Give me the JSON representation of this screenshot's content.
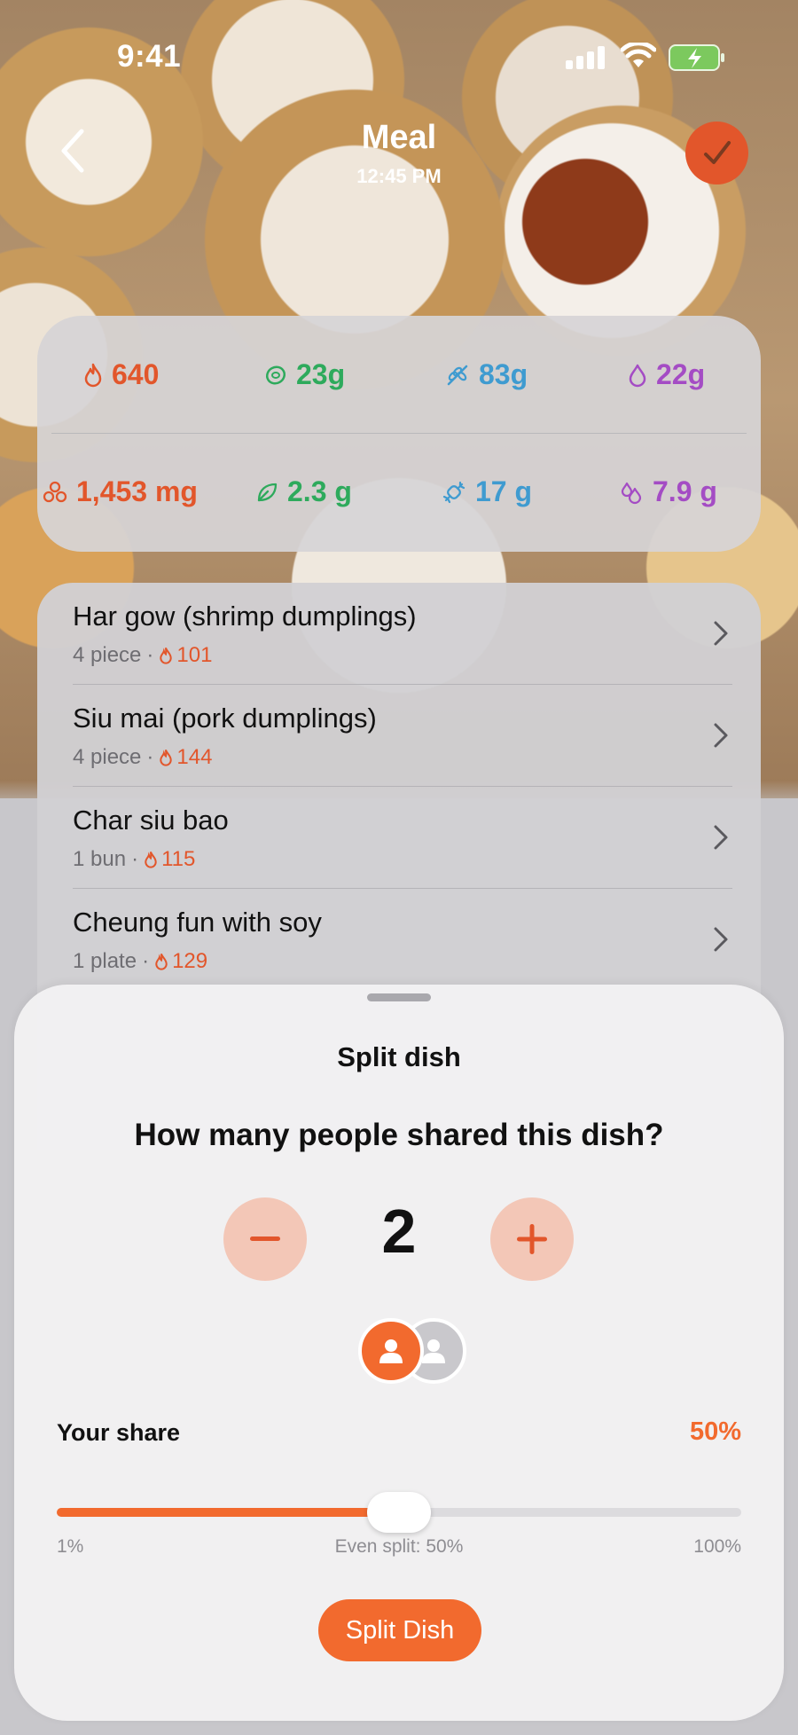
{
  "status_bar": {
    "time": "9:41"
  },
  "header": {
    "title": "Meal",
    "subtitle": "12:45 PM"
  },
  "nutrition": {
    "primary": [
      {
        "icon": "flame-icon",
        "value": "640",
        "color": "#e2562b"
      },
      {
        "icon": "protein-icon",
        "value": "23g",
        "color": "#2eaa5c"
      },
      {
        "icon": "carbs-icon",
        "value": "83g",
        "color": "#3f9bd0"
      },
      {
        "icon": "fat-drop-icon",
        "value": "22g",
        "color": "#a44cc4"
      }
    ],
    "secondary": [
      {
        "icon": "sodium-icon",
        "value": "1,453 mg",
        "color": "#e2562b"
      },
      {
        "icon": "fiber-leaf-icon",
        "value": "2.3 g",
        "color": "#2eaa5c"
      },
      {
        "icon": "sugar-icon",
        "value": "17 g",
        "color": "#3f9bd0"
      },
      {
        "icon": "sat-fat-icon",
        "value": "7.9 g",
        "color": "#a44cc4"
      }
    ]
  },
  "food_items": [
    {
      "name": "Har gow (shrimp dumplings)",
      "portion": "4 piece",
      "calories": "101"
    },
    {
      "name": "Siu mai (pork dumplings)",
      "portion": "4 piece",
      "calories": "144"
    },
    {
      "name": "Char siu bao",
      "portion": "1 bun",
      "calories": "115"
    },
    {
      "name": "Cheung fun with soy",
      "portion": "1 plate",
      "calories": "129"
    }
  ],
  "sheet": {
    "title": "Split dish",
    "question": "How many people shared this dish?",
    "people_count": "2",
    "share_label": "Your share",
    "share_value": "50%",
    "share_fraction": 0.5,
    "scale_min": "1%",
    "scale_mid": "Even split: 50%",
    "scale_max": "100%",
    "button_label": "Split Dish"
  },
  "colors": {
    "accent": "#f26a2e",
    "confirm": "#e2562b"
  }
}
